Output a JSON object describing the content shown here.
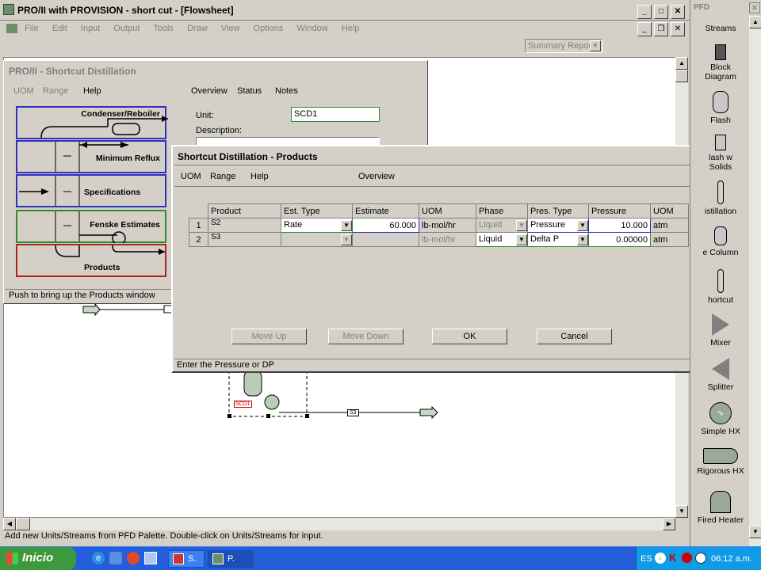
{
  "main_window": {
    "title": "PRO/II with PROVISION - short cut - [Flowsheet]",
    "menu": [
      "File",
      "Edit",
      "Input",
      "Output",
      "Tools",
      "Draw",
      "View",
      "Options",
      "Window",
      "Help"
    ],
    "report_dropdown": "Summary Report",
    "status": "Add new Units/Streams from PFD Palette.  Double-click on Units/Streams for input."
  },
  "shortcut_window": {
    "title": "PRO/II - Shortcut Distillation",
    "menu": {
      "uom": "UOM",
      "range": "Range",
      "help": "Help",
      "overview": "Overview",
      "status": "Status",
      "notes": "Notes"
    },
    "unit_label": "Unit:",
    "unit_value": "SCD1",
    "description_label": "Description:",
    "nav": {
      "condenser": "Condenser/Reboiler",
      "min_reflux": "Minimum Reflux",
      "specifications": "Specifications",
      "fenske": "Fenske Estimates",
      "products": "Products"
    },
    "status": "Push to bring up the Products window"
  },
  "products_dialog": {
    "title": "Shortcut Distillation - Products",
    "menu": {
      "uom": "UOM",
      "range": "Range",
      "help": "Help",
      "overview": "Overview"
    },
    "columns": [
      "Product",
      "Est. Type",
      "Estimate",
      "UOM",
      "Phase",
      "Pres. Type",
      "Pressure",
      "UOM"
    ],
    "rows": [
      {
        "num": "1",
        "product": "S2",
        "est_type": "Rate",
        "estimate": "60.000",
        "uom": "lb-mol/hr",
        "phase": "Liquid",
        "pres_type": "Pressure",
        "pressure": "10.000",
        "uom2": "atm"
      },
      {
        "num": "2",
        "product": "S3",
        "est_type": "",
        "estimate": "",
        "uom": "lb-mol/hr",
        "phase": "Liquid",
        "pres_type": "Delta P",
        "pressure": "0.00000",
        "uom2": "atm"
      }
    ],
    "buttons": {
      "move_up": "Move Up",
      "move_down": "Move Down",
      "ok": "OK",
      "cancel": "Cancel"
    },
    "status": "Enter the Pressure or DP"
  },
  "flowsheet": {
    "unit_tag": "SCD1",
    "stream_tag": "S3"
  },
  "palette": {
    "title": "PFD",
    "items": [
      "Streams",
      "Block Diagram",
      "Flash",
      "Flash w Solids",
      "Distillation",
      "Side Column",
      "Shortcut",
      "Mixer",
      "Splitter",
      "Simple HX",
      "Rigorous HX",
      "Fired Heater"
    ],
    "labels_visible": [
      "Streams",
      "Block\nDiagram",
      "Flash",
      "lash w\nSolids",
      "istillation",
      "e Column",
      "hortcut",
      "Mixer",
      "Splitter",
      "Simple HX",
      "Rigorous HX",
      "Fired Heater"
    ]
  },
  "taskbar": {
    "start": "Inicio",
    "tasks": [
      "S.",
      "P."
    ],
    "lang": "ES",
    "clock": "06:12 a.m."
  }
}
